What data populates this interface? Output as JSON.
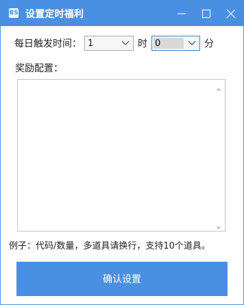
{
  "window": {
    "title": "设置定时福利",
    "app_icon": "BS"
  },
  "trigger": {
    "label": "每日触发时间：",
    "hour_value": "1",
    "hour_unit": "时",
    "minute_value": "0",
    "minute_unit": "分"
  },
  "reward": {
    "label": "奖励配置：",
    "value": ""
  },
  "hint": "例子：代码/数量，多道具请换行，支持10个道具。",
  "confirm_label": "确认设置",
  "colors": {
    "accent": "#4a90e2"
  },
  "icons": [
    "minimize-icon",
    "maximize-icon",
    "close-icon",
    "chevron-down-icon"
  ]
}
